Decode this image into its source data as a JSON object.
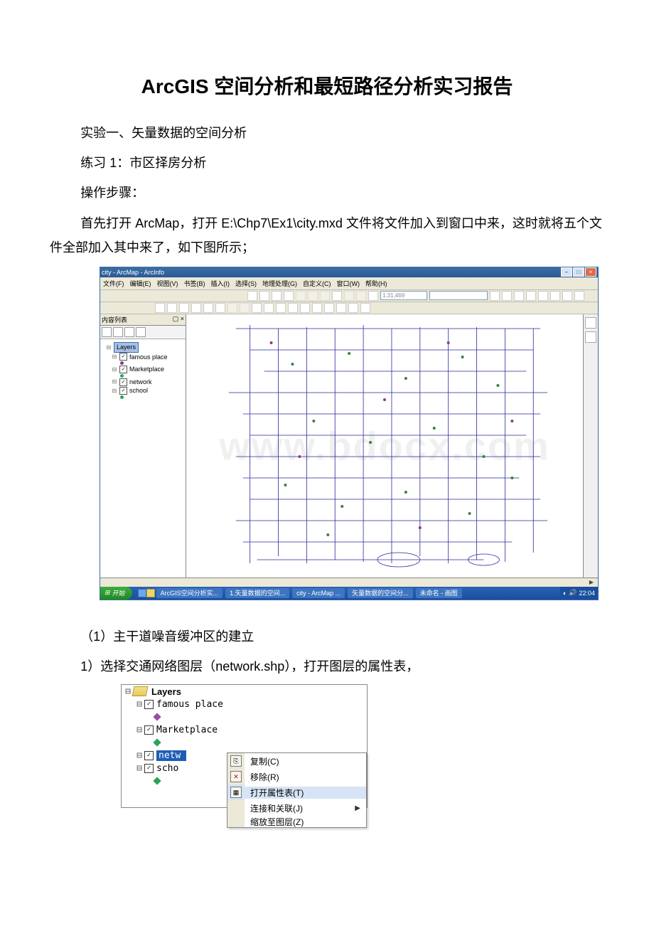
{
  "doc": {
    "title": "ArcGIS 空间分析和最短路径分析实习报告",
    "p1": "实验一、矢量数据的空间分析",
    "p2": "练习 1：市区择房分析",
    "p3": "操作步骤：",
    "p4": "首先打开 ArcMap，打开 E:\\Chp7\\Ex1\\city.mxd 文件将文件加入到窗口中来，这时就将五个文件全部加入其中来了，如下图所示；",
    "p5": "（1）主干道噪音缓冲区的建立",
    "p6": "1）选择交通网络图层（network.shp），打开图层的属性表，",
    "watermark": "www.bdocx.com"
  },
  "arcmap": {
    "title": "city - ArcMap - ArcInfo",
    "menu": [
      "文件(F)",
      "编辑(E)",
      "视图(V)",
      "书签(B)",
      "插入(I)",
      "选择(S)",
      "地理处理(G)",
      "自定义(C)",
      "窗口(W)",
      "帮助(H)"
    ],
    "scale": "1:31,469",
    "toc_heading": "内容列表",
    "toc_close_hint": "✕ ×",
    "layers_label": "Layers",
    "layers": [
      "famous place",
      "Marketplace",
      "network",
      "school"
    ]
  },
  "taskbar": {
    "start": "开始",
    "items": [
      "ArcGIS空间分析实...",
      "1.矢量数据的空间...",
      "city - ArcMap ...",
      "矢量数据的空间分...",
      "未命名 - 画图"
    ],
    "clock": "22:04"
  },
  "toc_shot": {
    "layers_label": "Layers",
    "items": [
      "famous place",
      "Marketplace",
      "netw",
      "scho"
    ],
    "selected": "netw",
    "menu": {
      "copy": "复制(C)",
      "remove": "移除(R)",
      "open_attr": "打开属性表(T)",
      "joins": "连接和关联(J)",
      "zoom_layer": "缩放至图层(Z)"
    }
  }
}
